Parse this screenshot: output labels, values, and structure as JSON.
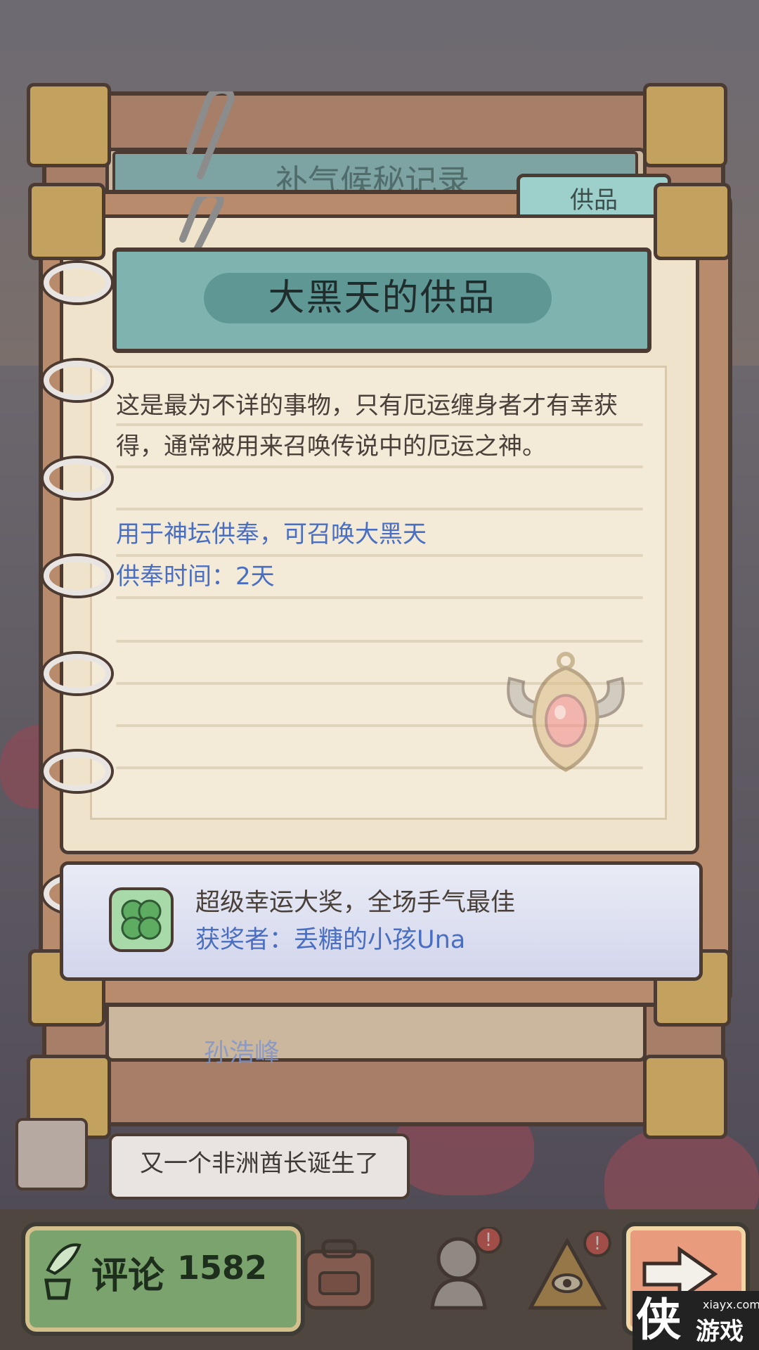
{
  "background": {
    "hidden_header_text": "补气候秘记录",
    "hidden_name": "孙浩峰"
  },
  "tab": {
    "label": "供品"
  },
  "item": {
    "title": "大黑天的供品",
    "description": "这是最为不详的事物，只有厄运缠身者才有幸获得，通常被用来召唤传说中的厄运之神。",
    "use": "用于神坛供奉，可召唤大黑天",
    "duration": "供奉时间：2天",
    "icon": "amulet-icon"
  },
  "award": {
    "line1": "超级幸运大奖，全场手气最佳",
    "line2": "获奖者：丢糖的小孩Una",
    "icon": "clover-icon"
  },
  "chat": {
    "bubble": "又一个非洲酋长诞生了"
  },
  "bottom_bar": {
    "comment_label": "评论",
    "comment_count": "1582",
    "icons": [
      "quill-icon",
      "backpack-icon",
      "bust-icon",
      "pyramid-eye-icon",
      "next-arrow-icon"
    ]
  },
  "watermark": {
    "big": "侠",
    "small": "游戏",
    "url": "xiayx.com"
  },
  "colors": {
    "title_banner": "#7fb3b0",
    "page": "#f0e3cb",
    "link_blue": "#4a6fc2",
    "comment_button": "#7ba36e",
    "next_button": "#e89b7d"
  }
}
